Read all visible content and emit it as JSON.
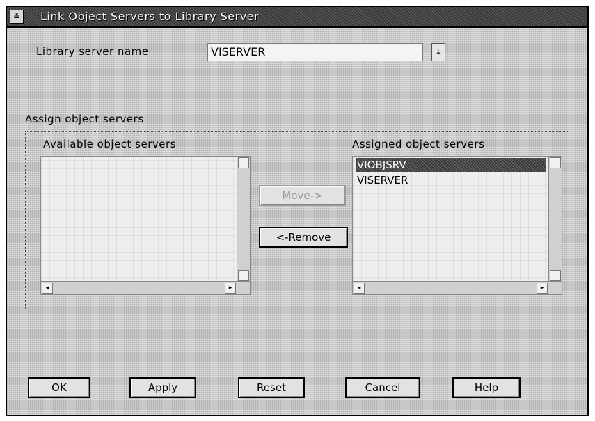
{
  "window": {
    "title": "Link Object Servers to Library Server",
    "system_menu_glyph": "≚"
  },
  "library_server": {
    "label": "Library server name",
    "value": "VISERVER",
    "dropdown_glyph": "⇣"
  },
  "assign_group": {
    "label": "Assign object servers",
    "available": {
      "label": "Available object servers",
      "items": []
    },
    "assigned": {
      "label": "Assigned object servers",
      "items": [
        "VIOBJSRV",
        "VISERVER"
      ],
      "selected_index": 0
    },
    "move_button": "Move->",
    "remove_button": "<-Remove"
  },
  "footer_buttons": {
    "ok": "OK",
    "apply": "Apply",
    "reset": "Reset",
    "cancel": "Cancel",
    "help": "Help"
  }
}
